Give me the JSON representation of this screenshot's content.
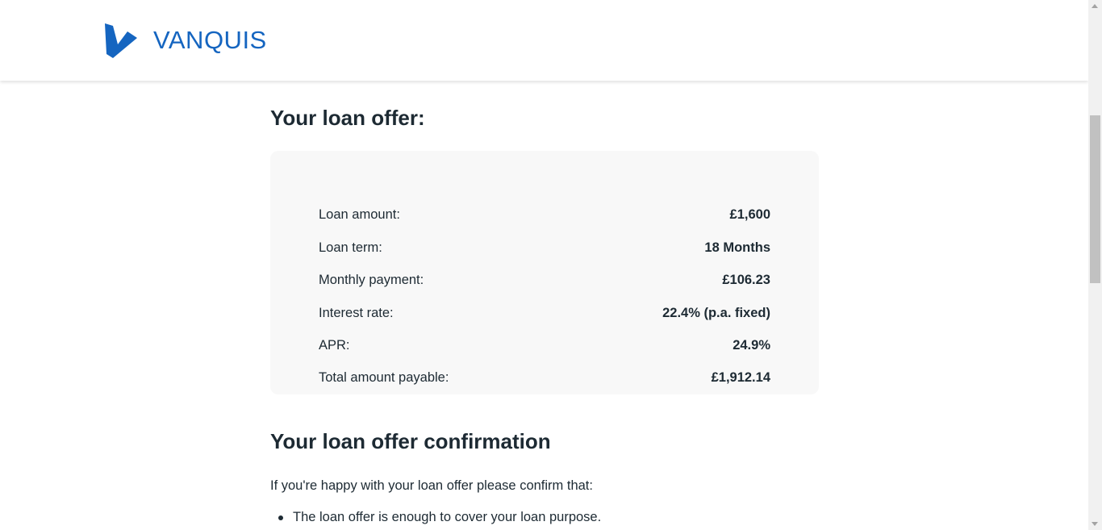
{
  "brand": {
    "name": "VANQUIS",
    "color": "#1565c0",
    "logo_icon": "vanquis-v-logo"
  },
  "offer": {
    "heading": "Your loan offer:",
    "rows": [
      {
        "label": "Loan amount:",
        "value": "£1,600"
      },
      {
        "label": "Loan term:",
        "value": "18 Months"
      },
      {
        "label": "Monthly payment:",
        "value": "£106.23"
      },
      {
        "label": "Interest rate:",
        "value": "22.4% (p.a. fixed)"
      },
      {
        "label": "APR:",
        "value": "24.9%"
      },
      {
        "label": "Total amount payable:",
        "value": "£1,912.14"
      }
    ]
  },
  "confirmation": {
    "heading": "Your loan offer confirmation",
    "intro": "If you're happy with your loan offer please confirm that:",
    "bullets": [
      "The loan offer is enough to cover your loan purpose."
    ]
  }
}
